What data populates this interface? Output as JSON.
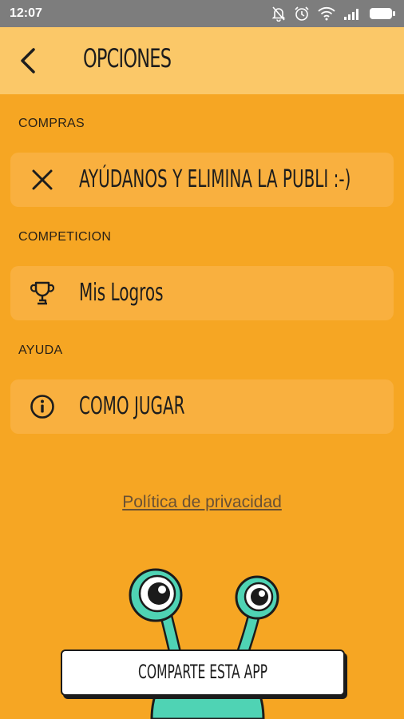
{
  "status_bar": {
    "time": "12:07",
    "icons": [
      "mute-bell-icon",
      "alarm-icon",
      "wifi-icon",
      "signal-icon",
      "battery-icon"
    ]
  },
  "header": {
    "back_icon": "back-arrow-icon",
    "title": "OPCIONES"
  },
  "sections": [
    {
      "label": "COMPRAS",
      "item": {
        "icon": "close-x-icon",
        "label": "AYÚDANOS Y ELIMINA LA PUBLI :-)"
      }
    },
    {
      "label": "COMPETICION",
      "item": {
        "icon": "trophy-icon",
        "label": "Mis Logros"
      }
    },
    {
      "label": "AYUDA",
      "item": {
        "icon": "info-icon",
        "label": "COMO JUGAR"
      }
    }
  ],
  "privacy_link": "Política de privacidad",
  "share_button": "COMPARTE ESTA APP",
  "colors": {
    "background": "#F6A623",
    "appbar": "#FBC868",
    "card": "#F9B03F",
    "monster": "#4FD3B4"
  }
}
